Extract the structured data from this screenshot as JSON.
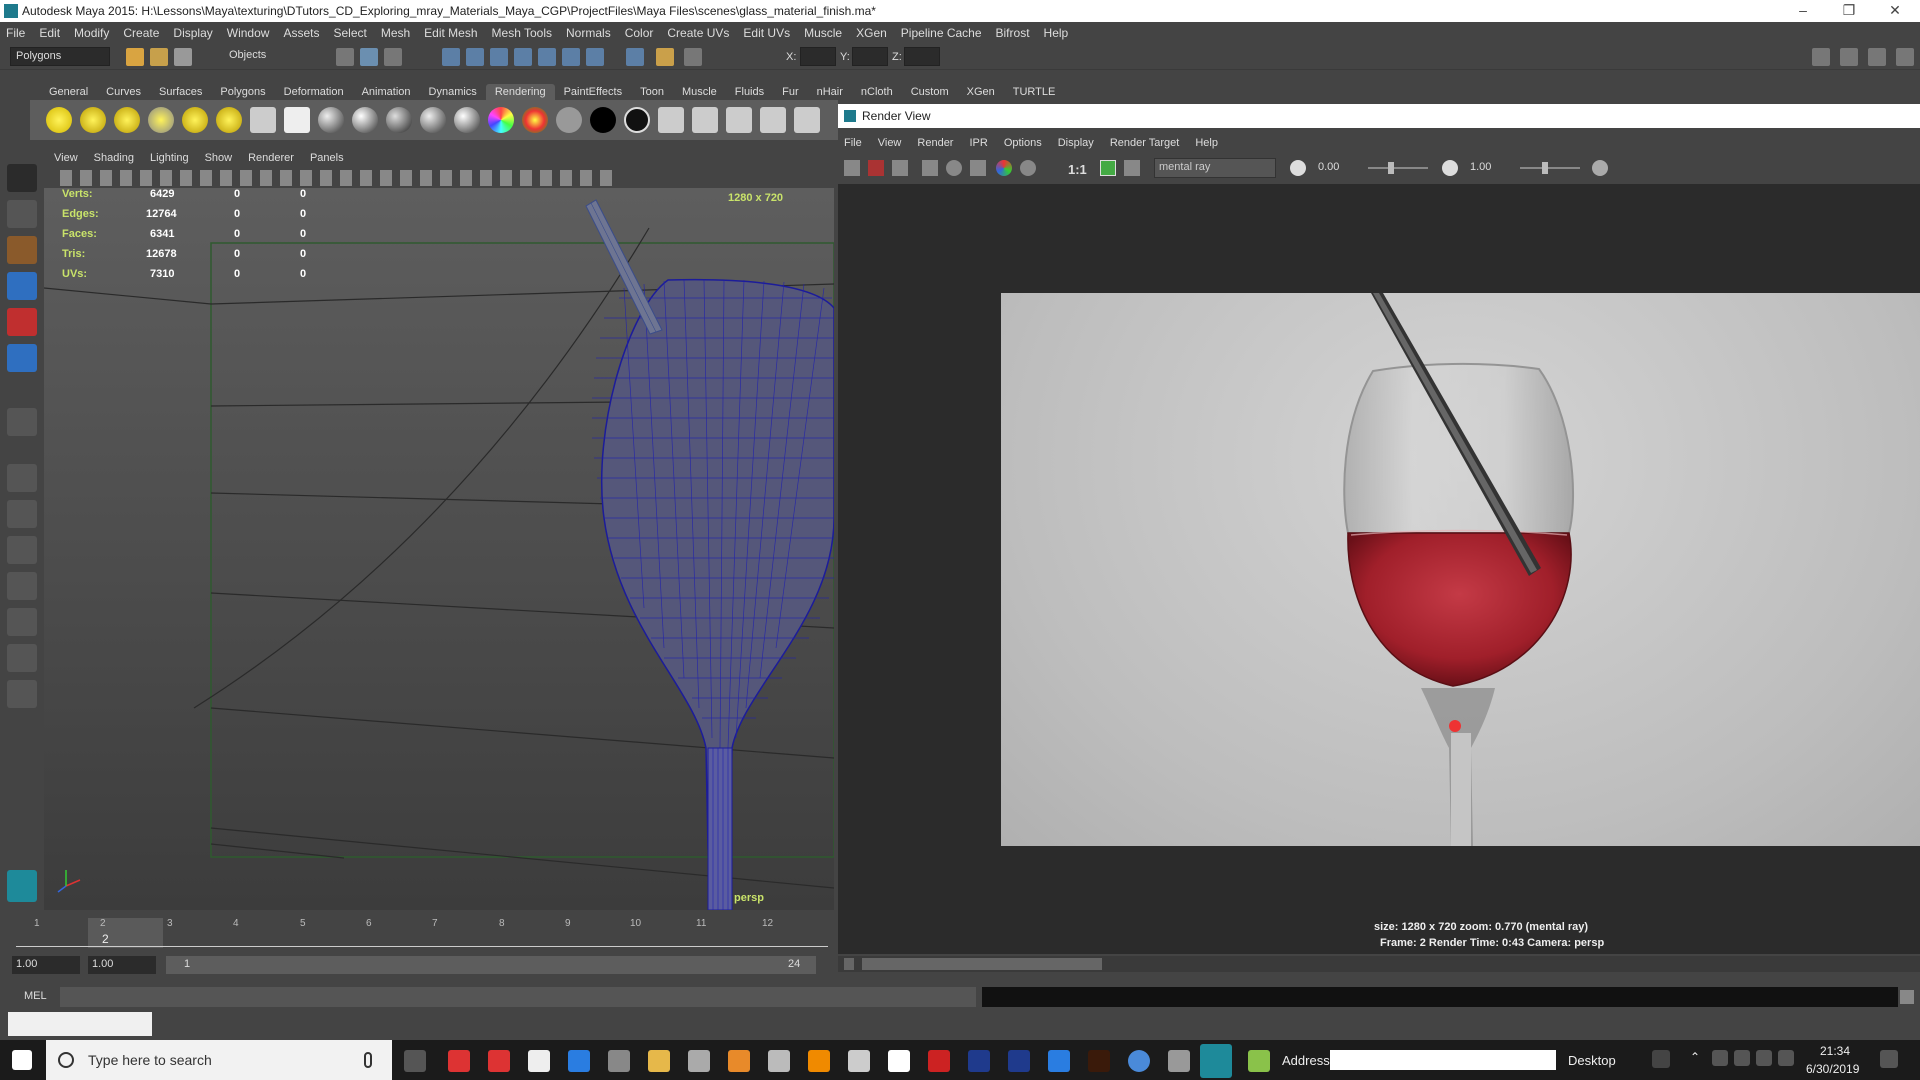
{
  "window": {
    "title": "Autodesk Maya 2015: H:\\Lessons\\Maya\\texturing\\DTutors_CD_Exploring_mray_Materials_Maya_CGP\\ProjectFiles\\Maya Files\\scenes\\glass_material_finish.ma*"
  },
  "menubar": [
    "File",
    "Edit",
    "Modify",
    "Create",
    "Display",
    "Window",
    "Assets",
    "Select",
    "Mesh",
    "Edit Mesh",
    "Mesh Tools",
    "Normals",
    "Color",
    "Create UVs",
    "Edit UVs",
    "Muscle",
    "XGen",
    "Pipeline Cache",
    "Bifrost",
    "Help"
  ],
  "statusline": {
    "mode": "Polygons",
    "selection_mode": "Objects",
    "x_label": "X:",
    "y_label": "Y:",
    "z_label": "Z:"
  },
  "shelf_tabs": [
    "General",
    "Curves",
    "Surfaces",
    "Polygons",
    "Deformation",
    "Animation",
    "Dynamics",
    "Rendering",
    "PaintEffects",
    "Toon",
    "Muscle",
    "Fluids",
    "Fur",
    "nHair",
    "nCloth",
    "Custom",
    "XGen",
    "TURTLE"
  ],
  "shelf_active": "Rendering",
  "viewport": {
    "menu": [
      "View",
      "Shading",
      "Lighting",
      "Show",
      "Renderer",
      "Panels"
    ],
    "resolution": "1280 x 720",
    "camera": "persp",
    "hud": [
      {
        "label": "Verts:",
        "v1": "6429",
        "v2": "0",
        "v3": "0"
      },
      {
        "label": "Edges:",
        "v1": "12764",
        "v2": "0",
        "v3": "0"
      },
      {
        "label": "Faces:",
        "v1": "6341",
        "v2": "0",
        "v3": "0"
      },
      {
        "label": "Tris:",
        "v1": "12678",
        "v2": "0",
        "v3": "0"
      },
      {
        "label": "UVs:",
        "v1": "7310",
        "v2": "0",
        "v3": "0"
      }
    ]
  },
  "render_view": {
    "title": "Render View",
    "menu": [
      "File",
      "View",
      "Render",
      "IPR",
      "Options",
      "Display",
      "Render Target",
      "Help"
    ],
    "ratio": "1:1",
    "renderer": "mental ray",
    "exposure": "0.00",
    "gamma": "1.00",
    "info_line1": "size: 1280 x 720 zoom: 0.770      (mental ray)",
    "info_line2": "Frame: 2      Render Time: 0:43      Camera: persp"
  },
  "timeline": {
    "ticks": [
      "1",
      "2",
      "3",
      "4",
      "5",
      "6",
      "7",
      "8",
      "9",
      "10",
      "11",
      "12"
    ],
    "current": "2"
  },
  "range": {
    "start": "1.00",
    "start2": "1.00",
    "slider_start": "1",
    "end": "24"
  },
  "command": {
    "lang": "MEL"
  },
  "taskbar": {
    "search_placeholder": "Type here to search",
    "address_label": "Address",
    "desktop_label": "Desktop",
    "time": "21:34",
    "date": "6/30/2019"
  },
  "colors": {
    "accent": "#4d8bd1",
    "hud_label": "#c9e36a",
    "wine": "#a01f2a"
  }
}
